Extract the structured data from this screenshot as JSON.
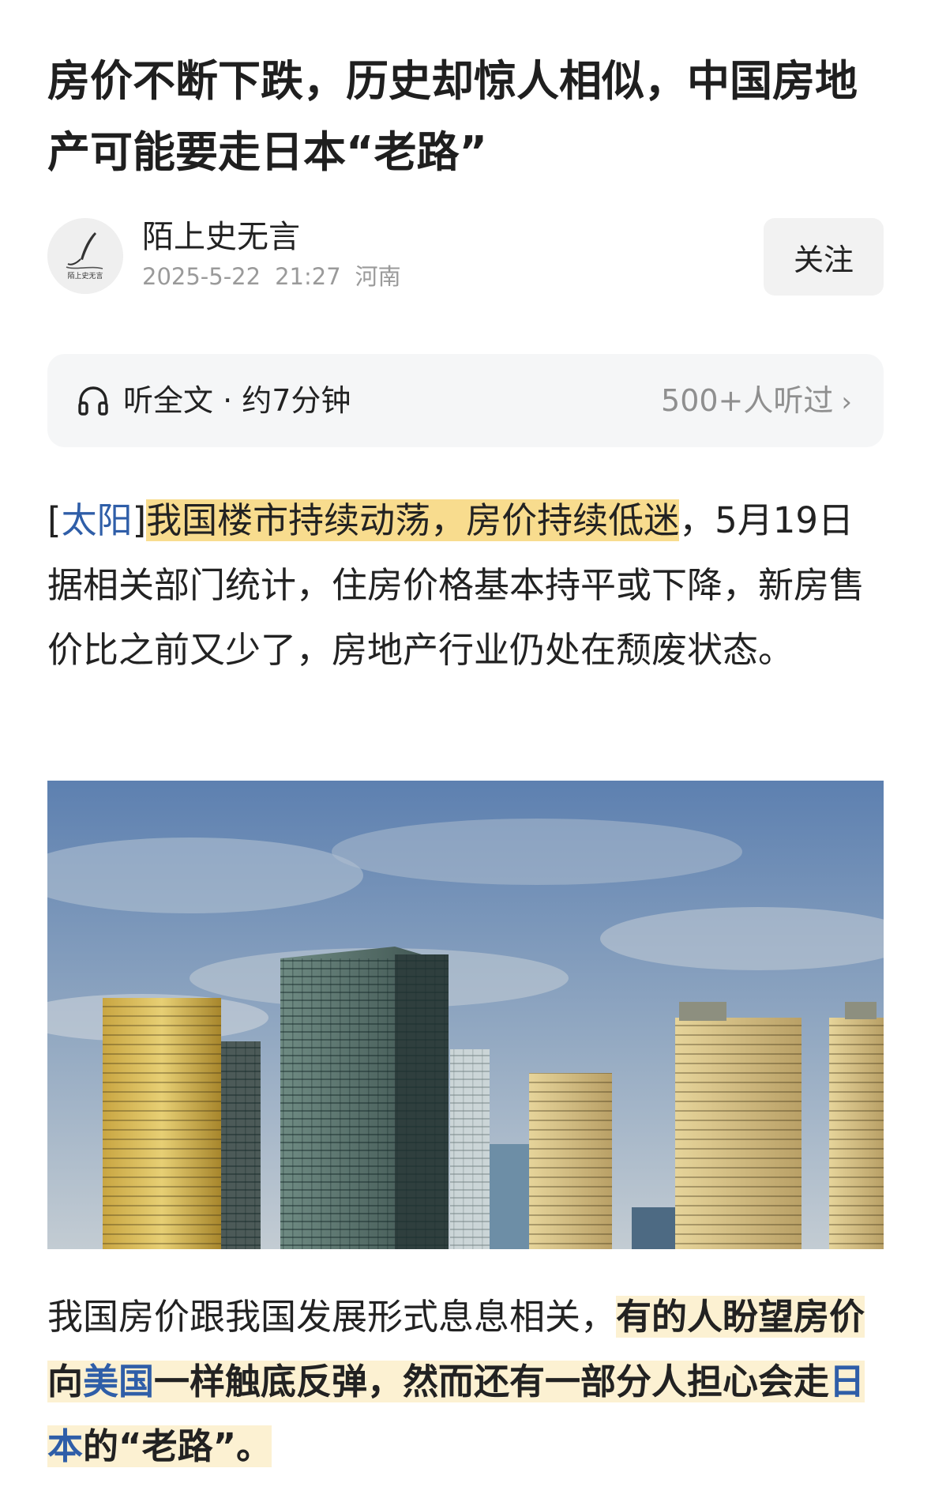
{
  "article": {
    "title": "房价不断下跌，历史却惊人相似，中国房地产可能要走日本“老路”"
  },
  "author": {
    "name": "陌上史无言",
    "avatar_text": "陌上史无言",
    "date": "2025-5-22",
    "time": "21:27",
    "location": "河南",
    "follow_label": "关注"
  },
  "listen": {
    "label": "听全文 · 约7分钟",
    "count": "500+人听过",
    "chevron": "›",
    "icon": "headphones-icon"
  },
  "paragraph1": {
    "tag_open": "[",
    "tag_text": "太阳",
    "tag_close": "]",
    "highlight": "我国楼市持续动荡，房价持续低迷",
    "rest": "，5月19日据相关部门统计，住房价格基本持平或下降，新房售价比之前又少了，房地产行业仍处在颓废状态。"
  },
  "image": {
    "description_icon": "city-skyline-photo"
  },
  "paragraph2": {
    "lead": "我国房价跟我国发展形式息息相关，",
    "hl_a": "有的人盼望房价向",
    "link_usa": "美国",
    "hl_b": "一样触底反弹，然而还有一部分人担心会走",
    "link_japan": "日本",
    "hl_c": "的“老路”。"
  },
  "colors": {
    "highlight": "#f8dc8e",
    "highlight_soft": "#fcf1d2",
    "link": "#2f5ea8",
    "muted": "#9a9a9a"
  }
}
